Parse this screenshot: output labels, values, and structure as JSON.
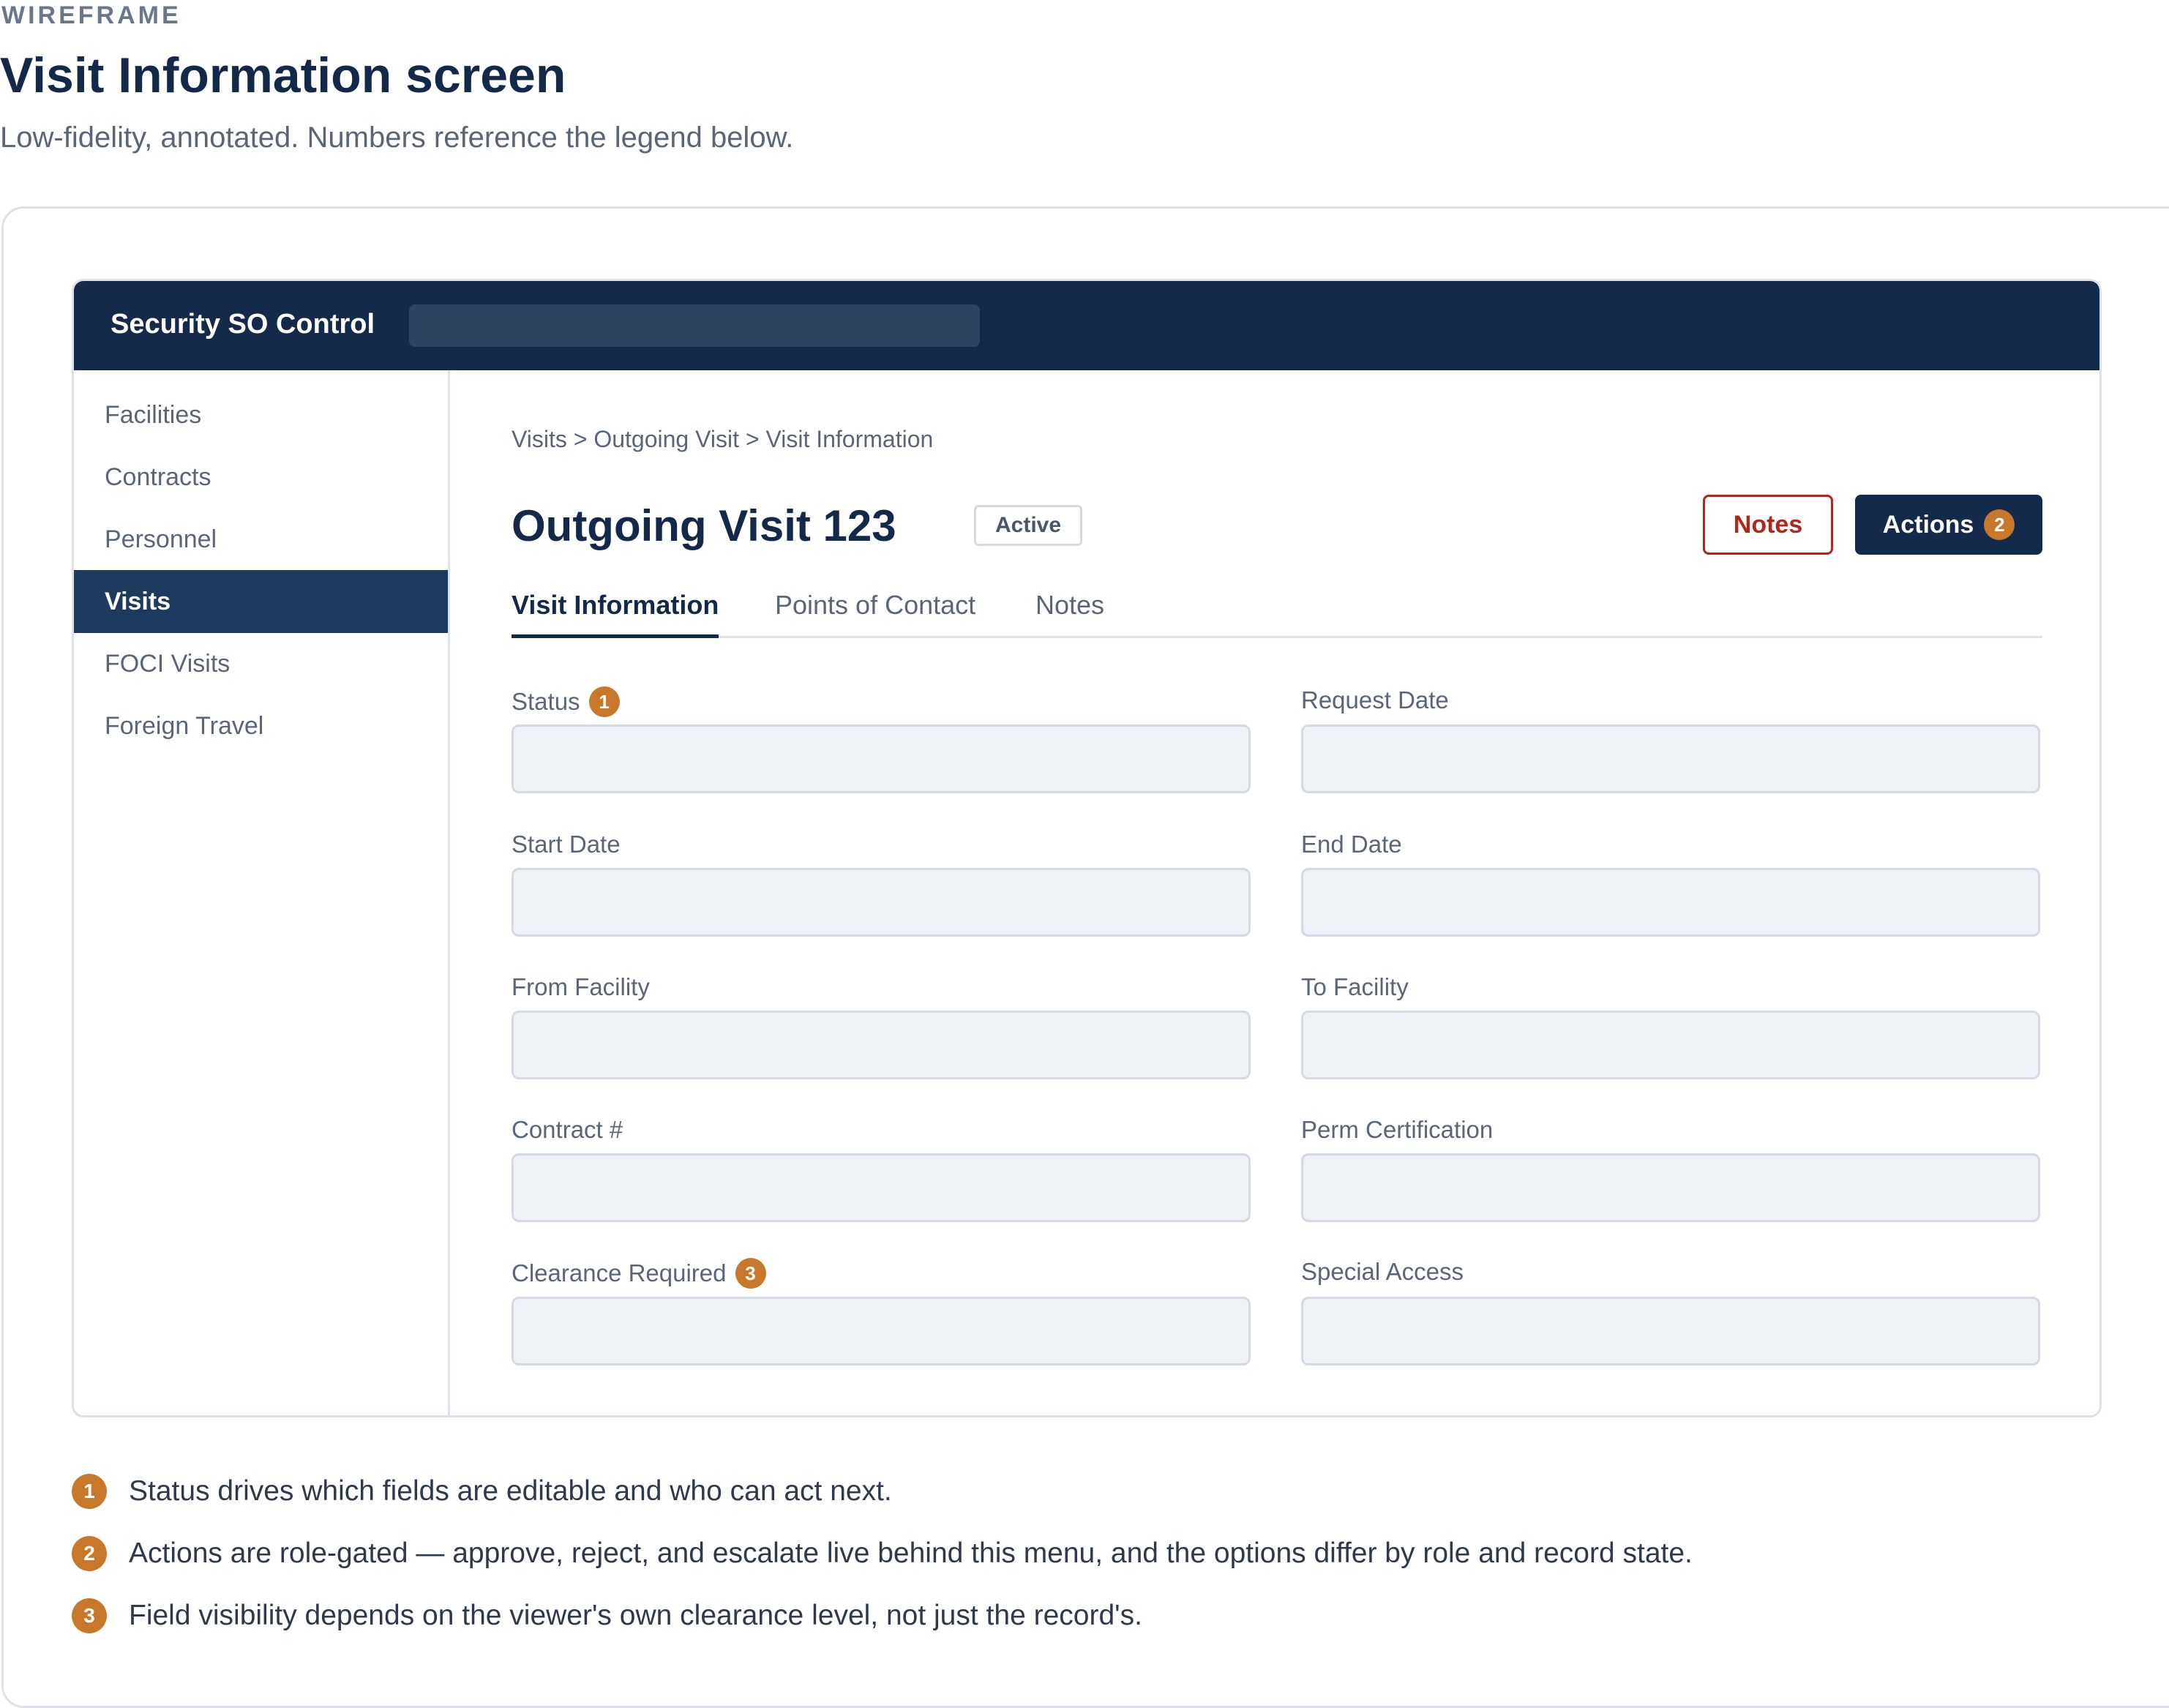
{
  "header": {
    "eyebrow": "WIREFRAME",
    "title": "Visit Information screen",
    "subtitle": "Low-fidelity, annotated. Numbers reference the legend below."
  },
  "app": {
    "name": "Security SO Control",
    "search_placeholder": ""
  },
  "sidebar": {
    "items": [
      {
        "label": "Facilities"
      },
      {
        "label": "Contracts"
      },
      {
        "label": "Personnel"
      },
      {
        "label": "Visits",
        "active": true
      },
      {
        "label": "FOCI Visits"
      },
      {
        "label": "Foreign Travel"
      }
    ]
  },
  "main": {
    "breadcrumb": "Visits > Outgoing Visit > Visit Information",
    "record_title": "Outgoing Visit 123",
    "status_badge": "Active",
    "notes_button": "Notes",
    "actions_button": "Actions",
    "actions_marker": "2",
    "tabs": [
      {
        "label": "Visit Information",
        "active": true
      },
      {
        "label": "Points of Contact"
      },
      {
        "label": "Notes"
      }
    ],
    "fields": {
      "status": {
        "label": "Status",
        "marker": "1",
        "value": ""
      },
      "request_date": {
        "label": "Request Date",
        "value": ""
      },
      "start_date": {
        "label": "Start Date",
        "value": ""
      },
      "end_date": {
        "label": "End Date",
        "value": ""
      },
      "from_facility": {
        "label": "From Facility",
        "value": ""
      },
      "to_facility": {
        "label": "To Facility",
        "value": ""
      },
      "contract_number": {
        "label": "Contract #",
        "value": ""
      },
      "perm_certification": {
        "label": "Perm Certification",
        "value": ""
      },
      "clearance_required": {
        "label": "Clearance Required",
        "marker": "3",
        "value": ""
      },
      "special_access": {
        "label": "Special Access",
        "value": ""
      }
    }
  },
  "legend": [
    {
      "marker": "1",
      "text": "Status drives which fields are editable and who can act next."
    },
    {
      "marker": "2",
      "text": "Actions are role-gated — approve, reject, and escalate live behind this menu, and the options differ by role and record state."
    },
    {
      "marker": "3",
      "text": "Field visibility depends on the viewer's own clearance level, not just the record's."
    }
  ],
  "colors": {
    "navy": "#142a4a",
    "sidebar_active": "#1d3b5f",
    "accent_marker": "#c8782a",
    "danger": "#b3261e"
  }
}
